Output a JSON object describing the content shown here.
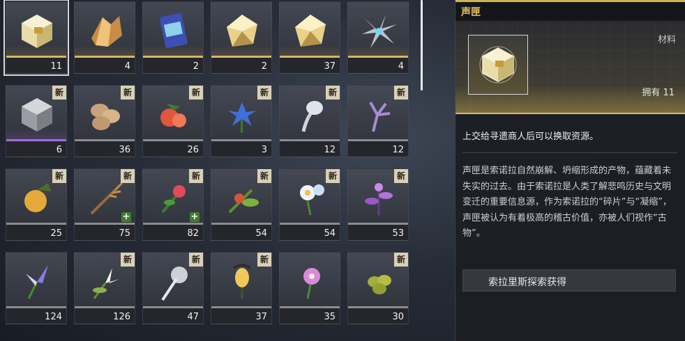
{
  "items": [
    {
      "count": "11",
      "badge": "",
      "plus": false,
      "quality": "gold",
      "icon": "gold-cube-icon",
      "selected": true
    },
    {
      "count": "4",
      "badge": "",
      "plus": false,
      "quality": "gold",
      "icon": "amber-crystal-cluster-icon"
    },
    {
      "count": "2",
      "badge": "",
      "plus": false,
      "quality": "gold",
      "icon": "blue-card-pack-icon"
    },
    {
      "count": "2",
      "badge": "",
      "plus": false,
      "quality": "gold",
      "icon": "gold-crystal-icon"
    },
    {
      "count": "37",
      "badge": "",
      "plus": false,
      "quality": "gold",
      "icon": "gold-crystal-icon"
    },
    {
      "count": "4",
      "badge": "",
      "plus": false,
      "quality": "gold",
      "icon": "crystal-spiral-icon"
    },
    {
      "count": "6",
      "badge": "新",
      "plus": false,
      "quality": "purple",
      "icon": "stone-cube-icon"
    },
    {
      "count": "36",
      "badge": "新",
      "plus": false,
      "quality": "none",
      "icon": "nuts-icon"
    },
    {
      "count": "26",
      "badge": "新",
      "plus": false,
      "quality": "none",
      "icon": "red-berries-icon"
    },
    {
      "count": "3",
      "badge": "新",
      "plus": false,
      "quality": "none",
      "icon": "blue-flower-icon"
    },
    {
      "count": "12",
      "badge": "新",
      "plus": false,
      "quality": "none",
      "icon": "silver-sprout-icon"
    },
    {
      "count": "12",
      "badge": "新",
      "plus": false,
      "quality": "none",
      "icon": "purple-coral-icon"
    },
    {
      "count": "25",
      "badge": "新",
      "plus": false,
      "quality": "none",
      "icon": "golden-fruit-icon"
    },
    {
      "count": "75",
      "badge": "新",
      "plus": true,
      "quality": "none",
      "icon": "wheat-stalk-icon"
    },
    {
      "count": "82",
      "badge": "新",
      "plus": true,
      "quality": "none",
      "icon": "red-lily-icon"
    },
    {
      "count": "54",
      "badge": "新",
      "plus": false,
      "quality": "none",
      "icon": "rose-hip-leaf-icon"
    },
    {
      "count": "54",
      "badge": "新",
      "plus": false,
      "quality": "none",
      "icon": "white-daisy-icon"
    },
    {
      "count": "53",
      "badge": "新",
      "plus": false,
      "quality": "none",
      "icon": "purple-herb-icon"
    },
    {
      "count": "124",
      "badge": "",
      "plus": false,
      "quality": "none",
      "icon": "violet-iris-icon"
    },
    {
      "count": "126",
      "badge": "新",
      "plus": false,
      "quality": "none",
      "icon": "white-lily-icon"
    },
    {
      "count": "47",
      "badge": "新",
      "plus": false,
      "quality": "none",
      "icon": "white-dandelion-icon"
    },
    {
      "count": "37",
      "badge": "新",
      "plus": false,
      "quality": "none",
      "icon": "glowing-bud-icon"
    },
    {
      "count": "35",
      "badge": "",
      "plus": false,
      "quality": "none",
      "icon": "pink-flower-icon"
    },
    {
      "count": "30",
      "badge": "新",
      "plus": false,
      "quality": "none",
      "icon": "green-berries-icon"
    }
  ],
  "detail": {
    "title": "声匣",
    "type": "材料",
    "owned": "拥有 11",
    "summary": "上交给寻遗商人后可以换取资源。",
    "description": "声匣是索诺拉自然崩解、坍缩形成的产物，蕴藏着未失实的过去。由于索诺拉是人类了解悲鸣历史与文明变迁的重要信息源，作为索诺拉的“碎片”与“凝缩”，声匣被认为有着极高的稽古价值，亦被人们视作“古物”。",
    "source_button": "索拉里斯探索获得",
    "accent_color": "#e6c45b"
  }
}
